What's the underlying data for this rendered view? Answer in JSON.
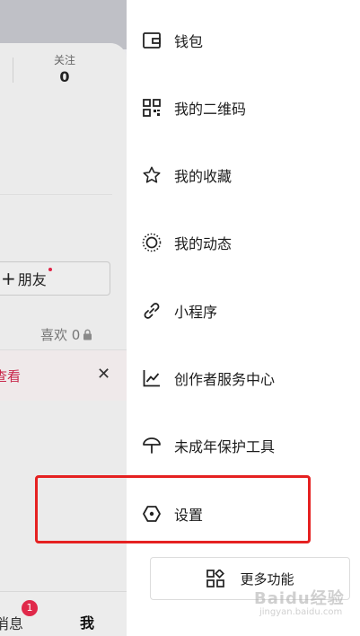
{
  "profile": {
    "following_label": "关注",
    "following_count": "0",
    "add_friend_label": "朋友",
    "likes_label": "喜欢 0",
    "notice_link": "查看",
    "notice_close": "✕"
  },
  "bottom_nav": {
    "messages_label": "消息",
    "messages_badge": "1",
    "me_label": "我"
  },
  "drawer": {
    "items": [
      {
        "label": "钱包",
        "icon": "wallet-icon"
      },
      {
        "label": "我的二维码",
        "icon": "qr-code-icon"
      },
      {
        "label": "我的收藏",
        "icon": "star-icon"
      },
      {
        "label": "我的动态",
        "icon": "activity-icon"
      },
      {
        "label": "小程序",
        "icon": "link-icon"
      },
      {
        "label": "创作者服务中心",
        "icon": "chart-icon"
      },
      {
        "label": "未成年保护工具",
        "icon": "umbrella-icon"
      },
      {
        "label": "设置",
        "icon": "settings-hexagon-icon"
      }
    ],
    "more_label": "更多功能",
    "highlight_color": "#e52121"
  },
  "watermark": {
    "brand": "Baidu经验",
    "url": "jingyan.baidu.com"
  }
}
